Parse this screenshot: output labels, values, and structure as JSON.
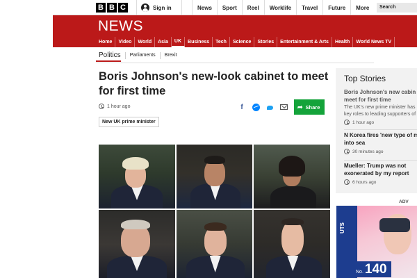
{
  "brand": {
    "letters": [
      "B",
      "B",
      "C"
    ],
    "section_title": "NEWS",
    "accent_color": "#bb1919"
  },
  "topbar": {
    "signin_label": "Sign in",
    "nav_items": [
      "News",
      "Sport",
      "Reel",
      "Worklife",
      "Travel",
      "Future",
      "More"
    ],
    "search_label": "Search"
  },
  "main_nav": {
    "items": [
      "Home",
      "Video",
      "World",
      "Asia",
      "UK",
      "Business",
      "Tech",
      "Science",
      "Stories",
      "Entertainment & Arts",
      "Health",
      "World News TV"
    ],
    "active": "UK"
  },
  "sub_nav": {
    "items": [
      "Politics",
      "Parliaments",
      "Brexit"
    ],
    "active": "Politics"
  },
  "article": {
    "headline": "Boris Johnson's new-look cabinet to meet for first time",
    "timestamp": "1 hour ago",
    "share_label": "Share",
    "share_icons": [
      "facebook-icon",
      "messenger-icon",
      "twitter-icon",
      "email-icon"
    ],
    "tag": "New UK prime minister"
  },
  "sidebar": {
    "title": "Top Stories",
    "stories": [
      {
        "title_lines": [
          "Boris Johnson's new cabin",
          "meet for first time"
        ],
        "summary_lines": [
          "The UK's new prime minister has",
          "key roles to leading supporters of"
        ],
        "time": "1 hour ago"
      },
      {
        "title_lines": [
          "N Korea fires 'new type of m",
          "into sea"
        ],
        "time": "30 minutes ago"
      },
      {
        "title_lines": [
          "Mueller: Trump was not",
          "exonerated by my report"
        ],
        "time": "6 hours ago"
      }
    ]
  },
  "advert": {
    "label": "ADV",
    "brand": "UTS",
    "badge_prefix": "No.",
    "badge_number": "140"
  }
}
